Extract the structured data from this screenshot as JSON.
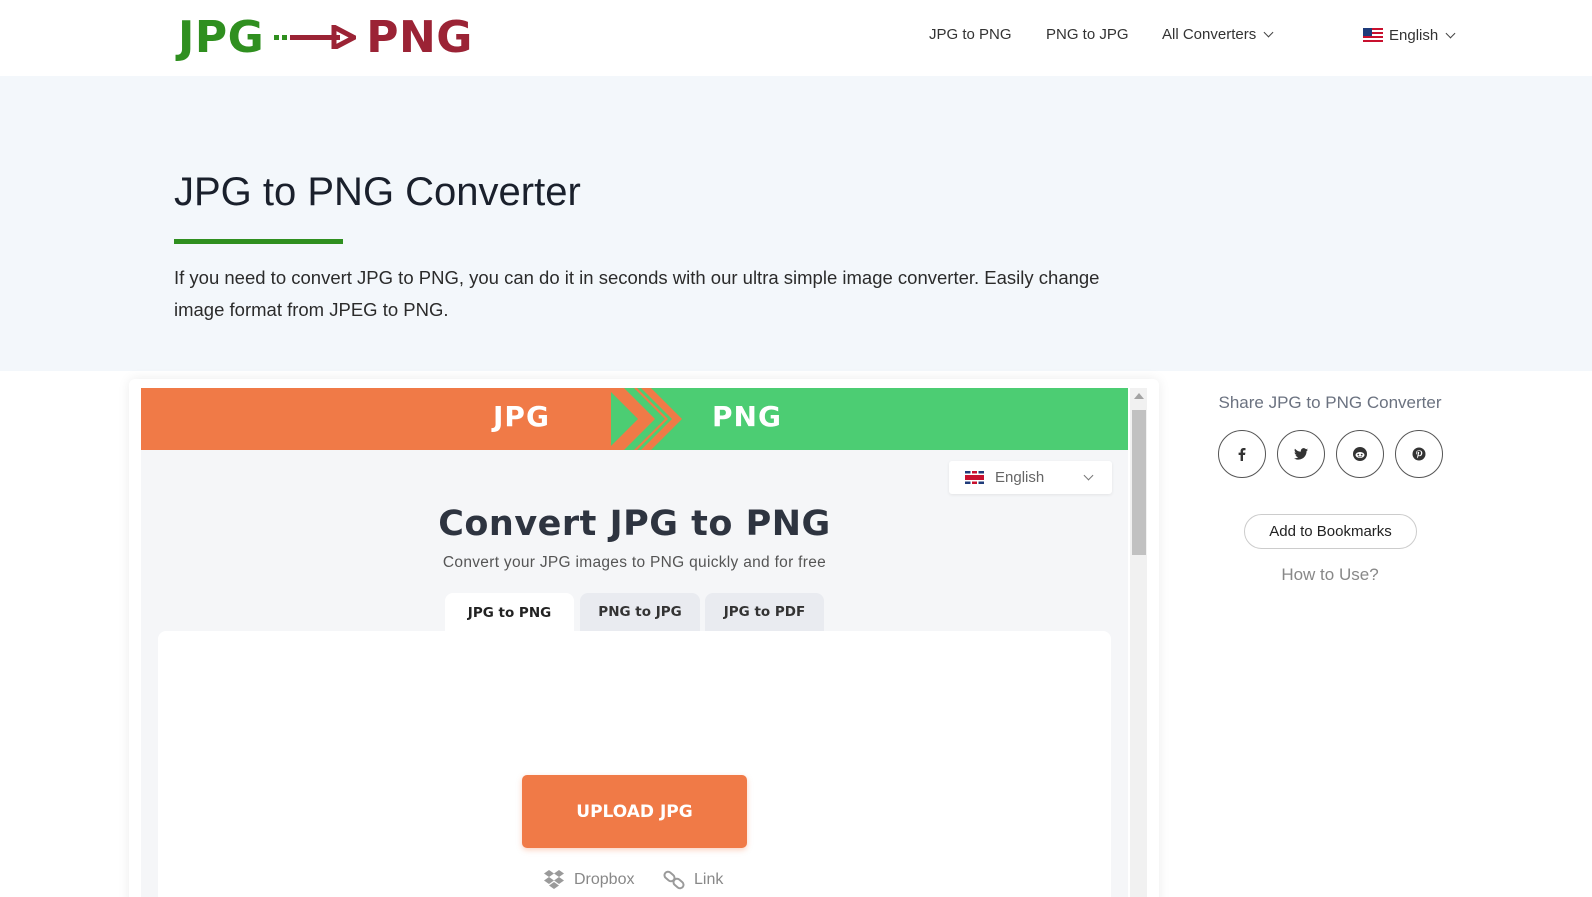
{
  "logo": {
    "left": "JPG",
    "right": "PNG"
  },
  "nav": {
    "items": [
      "JPG to PNG",
      "PNG to JPG",
      "All Converters"
    ],
    "language": "English"
  },
  "hero": {
    "title": "JPG to PNG Converter",
    "description": "If you need to convert JPG to PNG, you can do it in seconds with our ultra simple image converter. Easily change image format from JPEG to PNG."
  },
  "widget": {
    "banner_left": "JPG",
    "banner_right": "PNG",
    "language": "English",
    "title": "Convert JPG to PNG",
    "subtitle": "Convert your JPG images to PNG quickly and for free",
    "tabs": [
      "JPG to PNG",
      "PNG to JPG",
      "JPG to PDF"
    ],
    "active_tab": "JPG to PNG",
    "upload_label": "UPLOAD JPG",
    "sources": [
      "Dropbox",
      "Link"
    ]
  },
  "sidebar": {
    "share_title": "Share JPG to PNG Converter",
    "social": [
      "facebook-icon",
      "twitter-icon",
      "reddit-icon",
      "pinterest-icon"
    ],
    "bookmark_label": "Add to Bookmarks",
    "howto_label": "How to Use?"
  },
  "colors": {
    "logo_green": "#2f8f1f",
    "logo_red": "#9b2335",
    "banner_orange": "#f07a47",
    "banner_green": "#4ccd73",
    "hero_bg": "#f3f7fb"
  }
}
